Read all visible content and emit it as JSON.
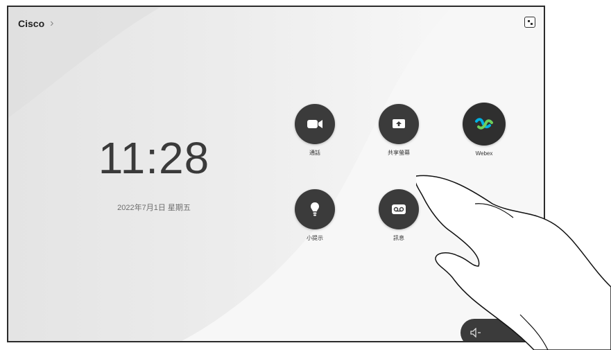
{
  "header": {
    "brand": "Cisco",
    "chevron": "›"
  },
  "clock": {
    "time": "11:28",
    "date": "2022年7月1日 星期五"
  },
  "tiles": [
    {
      "label": "通話",
      "icon": "video-camera-icon"
    },
    {
      "label": "共享螢幕",
      "icon": "share-screen-icon"
    },
    {
      "label": "Webex",
      "icon": "webex-icon"
    },
    {
      "label": "小提示",
      "icon": "lightbulb-icon"
    },
    {
      "label": "訊息",
      "icon": "voicemail-icon"
    }
  ],
  "corner": {
    "icon": "device-status-icon"
  },
  "volume": {
    "down_icon": "volume-down-icon",
    "up_icon": "volume-up-icon"
  },
  "colors": {
    "button_bg": "#3b3b3b",
    "bg": "#ececec",
    "text": "#3a3a3a"
  }
}
